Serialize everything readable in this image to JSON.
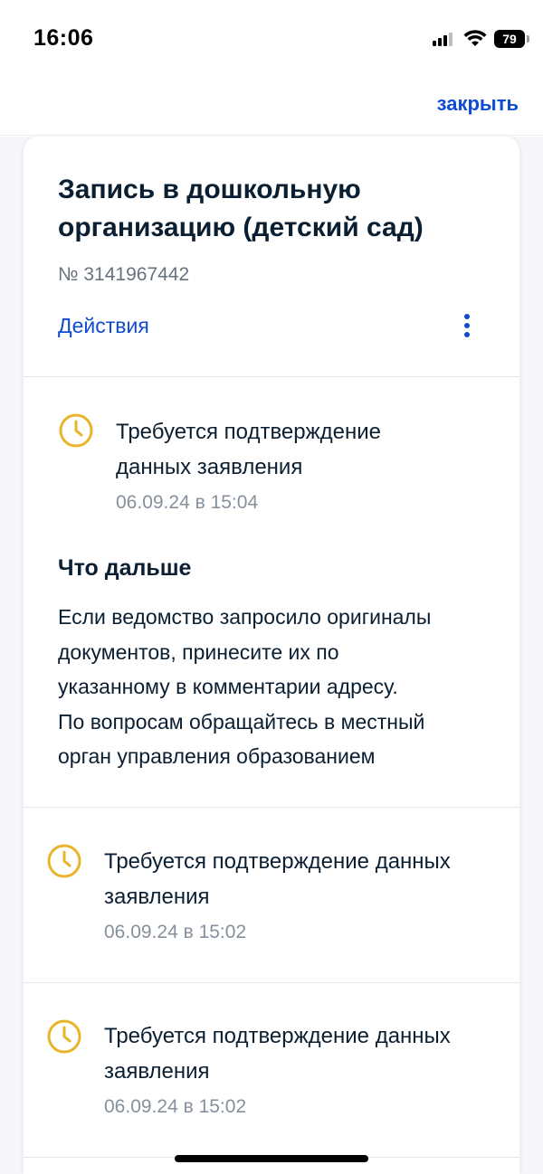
{
  "status_bar": {
    "time": "16:06",
    "battery": "79",
    "icons": [
      "cellular-signal-icon",
      "wifi-icon",
      "battery-icon"
    ]
  },
  "top_bar": {
    "close_label": "закрыть"
  },
  "application": {
    "title": "Запись в дошкольную организацию (детский сад)",
    "number": "№ 3141967442",
    "actions_label": "Действия"
  },
  "current_status": {
    "text_line1": "Требуется подтверждение",
    "text_line2": "данных заявления",
    "date": "06.09.24 в 15:04"
  },
  "next_steps": {
    "title": "Что дальше",
    "line1": "Если ведомство запросило оригиналы",
    "line2": "документов, принесите их по",
    "line3": "указанному в комментарии адресу.",
    "line4": "По вопросам обращайтесь в местный",
    "line5": "орган управления образованием"
  },
  "history": [
    {
      "text_line1": "Требуется подтверждение данных",
      "text_line2": "заявления",
      "date": "06.09.24 в 15:02"
    },
    {
      "text_line1": "Требуется подтверждение данных",
      "text_line2": "заявления",
      "date": "06.09.24 в 15:02"
    }
  ],
  "colors": {
    "accent": "#0d4cd3",
    "status_icon": "#e9b42a",
    "text": "#0b1f33",
    "muted": "#86909c"
  }
}
